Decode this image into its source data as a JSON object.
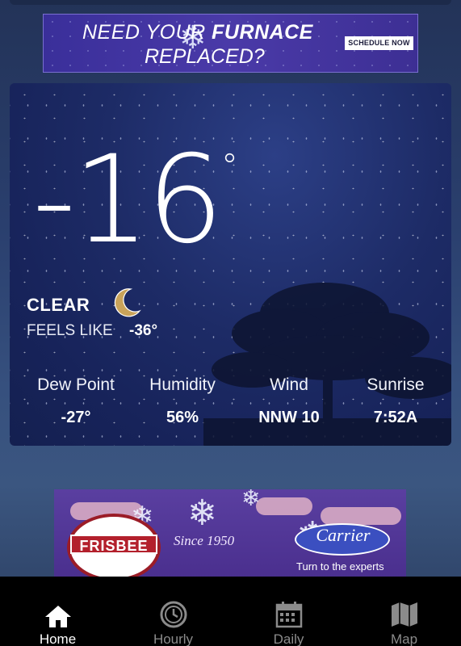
{
  "ad_top": {
    "line1_a": "NEED YOUR ",
    "line1_b": "FURNACE",
    "line2": "REPLACED?",
    "cta": "SCHEDULE NOW"
  },
  "current": {
    "temperature": "-16",
    "degree_symbol": "°",
    "condition": "CLEAR",
    "feels_like_label": "FEELS LIKE",
    "feels_like_value": "-36°",
    "stats": [
      {
        "label": "Dew Point",
        "value": "-27°"
      },
      {
        "label": "Humidity",
        "value": "56%"
      },
      {
        "label": "Wind",
        "value": "NNW 10"
      },
      {
        "label": "Sunrise",
        "value": "7:52A"
      }
    ]
  },
  "ad_bottom": {
    "brand_left": "FRISBEE",
    "since": "Since 1950",
    "brand_right": "Carrier",
    "tagline": "Turn to the experts"
  },
  "nav": {
    "items": [
      {
        "label": "Home",
        "icon": "home-icon",
        "active": true
      },
      {
        "label": "Hourly",
        "icon": "clock-icon",
        "active": false
      },
      {
        "label": "Daily",
        "icon": "calendar-icon",
        "active": false
      },
      {
        "label": "Map",
        "icon": "map-icon",
        "active": false
      }
    ]
  },
  "colors": {
    "nav_background": "#000000",
    "nav_inactive": "#8b8b8b",
    "moon": "#c9a35a"
  }
}
